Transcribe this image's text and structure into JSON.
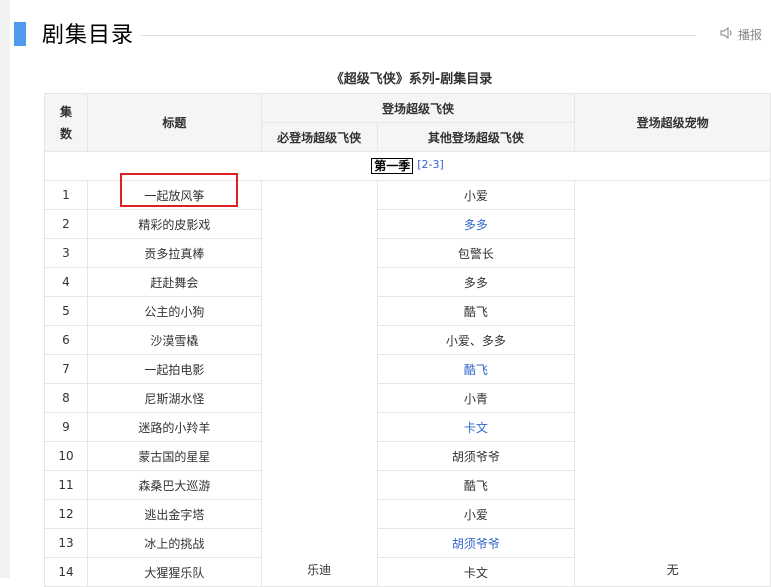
{
  "section": {
    "title": "剧集目录",
    "report_label": "播报"
  },
  "table": {
    "caption": "《超级飞侠》系列-剧集目录",
    "headers": {
      "episode": "集数",
      "title": "标题",
      "appear_group": "登场超级飞侠",
      "must_appear": "必登场超级飞侠",
      "others": "其他登场超级飞侠",
      "pet": "登场超级宠物"
    },
    "season": {
      "label": "第一季",
      "ref": "[2-3]"
    },
    "must_appear_value": "乐迪",
    "pet_value": "无",
    "rows": [
      {
        "num": "1",
        "title": "一起放风筝",
        "others": "小爱",
        "others_link": false
      },
      {
        "num": "2",
        "title": "精彩的皮影戏",
        "others": "多多",
        "others_link": true
      },
      {
        "num": "3",
        "title": "贡多拉真棒",
        "others": "包警长",
        "others_link": false
      },
      {
        "num": "4",
        "title": "赶赴舞会",
        "others": "多多",
        "others_link": false
      },
      {
        "num": "5",
        "title": "公主的小狗",
        "others": "酷飞",
        "others_link": false
      },
      {
        "num": "6",
        "title": "沙漠雪橇",
        "others": "小爱、多多",
        "others_link": false
      },
      {
        "num": "7",
        "title": "一起拍电影",
        "others": "酷飞",
        "others_link": true
      },
      {
        "num": "8",
        "title": "尼斯湖水怪",
        "others": "小青",
        "others_link": false
      },
      {
        "num": "9",
        "title": "迷路的小羚羊",
        "others": "卡文",
        "others_link": true
      },
      {
        "num": "10",
        "title": "蒙古国的星星",
        "others": "胡须爷爷",
        "others_link": false
      },
      {
        "num": "11",
        "title": "森桑巴大巡游",
        "others": "酷飞",
        "others_link": false
      },
      {
        "num": "12",
        "title": "逃出金字塔",
        "others": "小爱",
        "others_link": false
      },
      {
        "num": "13",
        "title": "冰上的挑战",
        "others": "胡须爷爷",
        "others_link": true
      },
      {
        "num": "14",
        "title": "大猩猩乐队",
        "others": "卡文",
        "others_link": false
      }
    ]
  },
  "colors": {
    "accent": "#4f9cee",
    "link": "#3366cc",
    "highlight": "#e02020"
  }
}
